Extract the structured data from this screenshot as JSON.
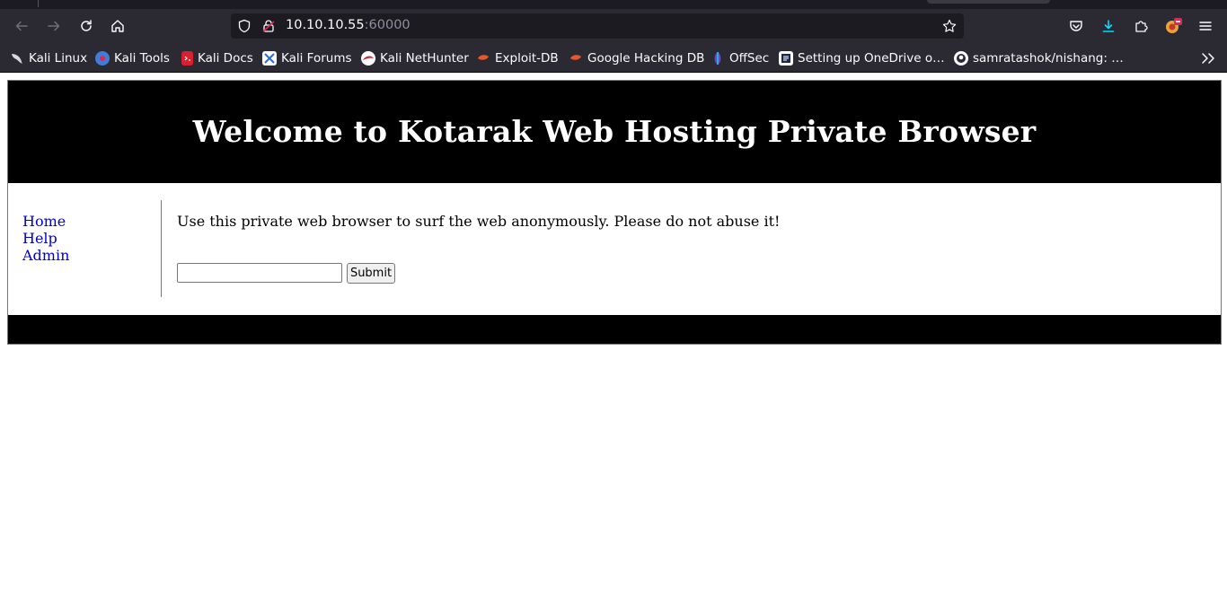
{
  "browser": {
    "url_host": "10.10.10.55",
    "url_port": ":60000",
    "icons": {
      "back": "back-arrow-icon",
      "forward": "forward-arrow-icon",
      "reload": "reload-icon",
      "home": "home-icon",
      "security": "shield-icon",
      "insecure": "insecure-lock-icon",
      "bookmark_star": "star-icon",
      "pocket": "pocket-icon",
      "downloads": "download-icon",
      "extensions": "puzzle-icon",
      "profile": "profile-badge-icon",
      "menu": "hamburger-menu-icon",
      "more_bookmarks": "double-chevron-icon"
    },
    "colors": {
      "chrome_bg": "#2b2a33",
      "urlbar_bg": "#1c1b22",
      "download_accent": "#00ddff"
    }
  },
  "bookmarks": [
    {
      "label": "Kali Linux",
      "icon": "kali-dragon-icon"
    },
    {
      "label": "Kali Tools",
      "icon": "kali-tools-icon"
    },
    {
      "label": "Kali Docs",
      "icon": "kali-docs-icon"
    },
    {
      "label": "Kali Forums",
      "icon": "kali-forums-icon"
    },
    {
      "label": "Kali NetHunter",
      "icon": "nethunter-icon"
    },
    {
      "label": "Exploit-DB",
      "icon": "exploit-db-icon"
    },
    {
      "label": "Google Hacking DB",
      "icon": "ghdb-icon"
    },
    {
      "label": "OffSec",
      "icon": "offsec-icon"
    },
    {
      "label": "Setting up OneDrive o…",
      "icon": "onedrive-page-icon"
    },
    {
      "label": "samratashok/nishang: …",
      "icon": "github-icon"
    }
  ],
  "site": {
    "title": "Welcome to Kotarak Web Hosting Private Browser",
    "nav": [
      {
        "label": "Home"
      },
      {
        "label": "Help"
      },
      {
        "label": "Admin"
      }
    ],
    "description": "Use this private web browser to surf the web anonymously. Please do not abuse it!",
    "input_value": "",
    "submit_label": "Submit",
    "colors": {
      "header_bg": "#000000",
      "link": "#0000cc"
    }
  }
}
